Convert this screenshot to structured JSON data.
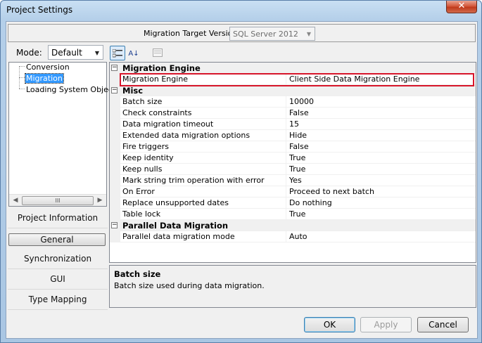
{
  "window": {
    "title": "Project Settings",
    "close_glyph": "✕"
  },
  "migration_target": {
    "label": "Migration Target Version :",
    "value": "SQL Server 2012"
  },
  "mode": {
    "label": "Mode:",
    "value": "Default"
  },
  "tree": {
    "items": [
      {
        "label": "Conversion",
        "selected": false
      },
      {
        "label": "Migration",
        "selected": true
      },
      {
        "label": "Loading System Objects",
        "selected": false
      }
    ],
    "scroll_thumb": "III"
  },
  "nav": {
    "items": [
      {
        "label": "Project Information",
        "active": false
      },
      {
        "label": "General",
        "active": true
      },
      {
        "label": "Synchronization",
        "active": false
      },
      {
        "label": "GUI",
        "active": false
      },
      {
        "label": "Type Mapping",
        "active": false
      }
    ]
  },
  "toolbar": {
    "categorized_icon": "categorized-icon",
    "alphabetical_icon": "sort-alphabetical-icon",
    "alphabetical_glyph": "A↓",
    "property_pages_icon": "property-pages-icon"
  },
  "property_grid": {
    "categories": [
      {
        "name": "Migration Engine",
        "properties": [
          {
            "name": "Migration Engine",
            "value": "Client Side Data Migration Engine"
          }
        ]
      },
      {
        "name": "Misc",
        "properties": [
          {
            "name": "Batch size",
            "value": "10000"
          },
          {
            "name": "Check constraints",
            "value": "False"
          },
          {
            "name": "Data migration timeout",
            "value": "15"
          },
          {
            "name": "Extended data migration options",
            "value": "Hide"
          },
          {
            "name": "Fire triggers",
            "value": "False"
          },
          {
            "name": "Keep identity",
            "value": "True"
          },
          {
            "name": "Keep nulls",
            "value": "True"
          },
          {
            "name": "Mark string trim operation with error",
            "value": "Yes"
          },
          {
            "name": "On Error",
            "value": "Proceed to next batch"
          },
          {
            "name": "Replace unsupported dates",
            "value": "Do nothing"
          },
          {
            "name": "Table lock",
            "value": "True"
          }
        ]
      },
      {
        "name": "Parallel Data Migration",
        "properties": [
          {
            "name": "Parallel data migration mode",
            "value": "Auto"
          }
        ]
      }
    ],
    "collapse_glyph": "−",
    "highlight_color": "#d7152a"
  },
  "description": {
    "title": "Batch size",
    "text": "Batch size used during data migration."
  },
  "buttons": {
    "ok": "OK",
    "apply": "Apply",
    "cancel": "Cancel"
  }
}
